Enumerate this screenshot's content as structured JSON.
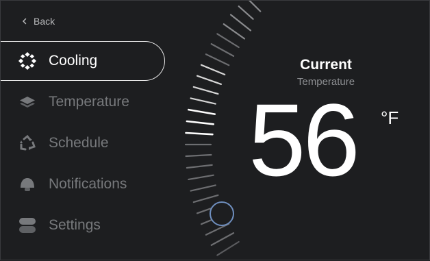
{
  "nav": {
    "back_label": "Back"
  },
  "sidebar": {
    "items": [
      {
        "label": "Cooling",
        "icon": "cooling-icon",
        "active": true
      },
      {
        "label": "Temperature",
        "icon": "layers-icon",
        "active": false
      },
      {
        "label": "Schedule",
        "icon": "recycle-icon",
        "active": false
      },
      {
        "label": "Notifications",
        "icon": "bell-icon",
        "active": false
      },
      {
        "label": "Settings",
        "icon": "toggle-icon",
        "active": false
      }
    ]
  },
  "thermostat": {
    "title": "Current",
    "subtitle": "Temperature",
    "value": "56",
    "unit": "°F"
  },
  "colors": {
    "background": "#1d1e20",
    "knob_ring": "#6f8fbf",
    "text_primary": "#ffffff",
    "text_muted": "#77797c"
  }
}
